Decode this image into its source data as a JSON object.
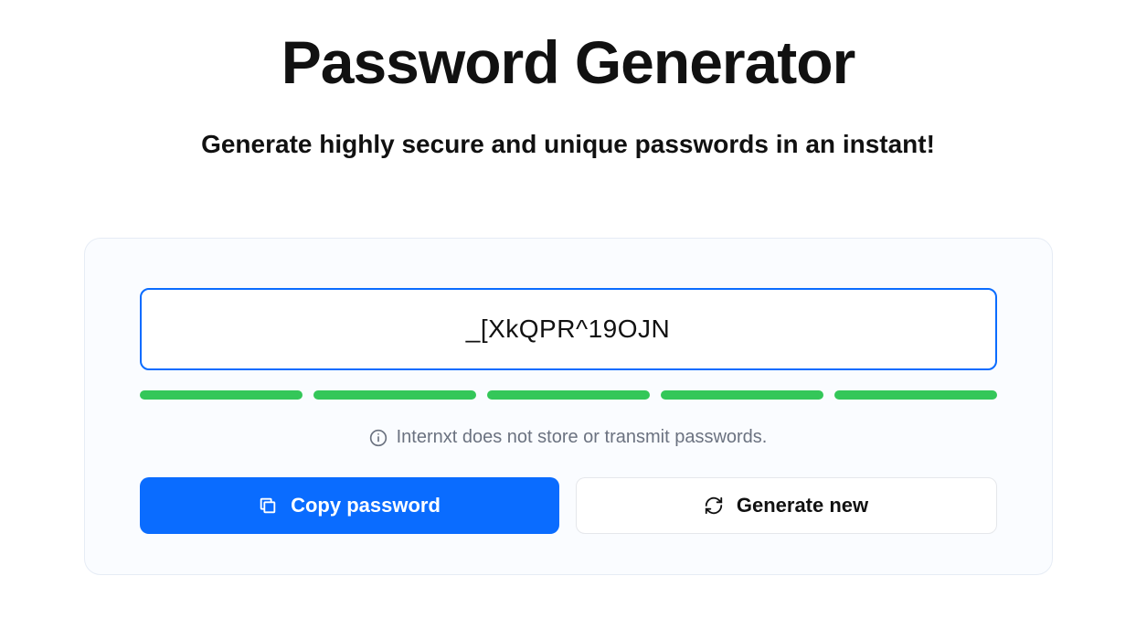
{
  "header": {
    "title": "Password Generator",
    "subtitle": "Generate highly secure and unique passwords in an instant!"
  },
  "generator": {
    "password": "_[XkQPR^19OJN",
    "strength_segments": 5,
    "strength_color": "#34c759",
    "note": "Internxt does not store or transmit passwords.",
    "copy_label": "Copy password",
    "generate_label": "Generate new"
  },
  "colors": {
    "accent": "#0a6cff",
    "strength": "#34c759",
    "muted": "#6b7280"
  }
}
